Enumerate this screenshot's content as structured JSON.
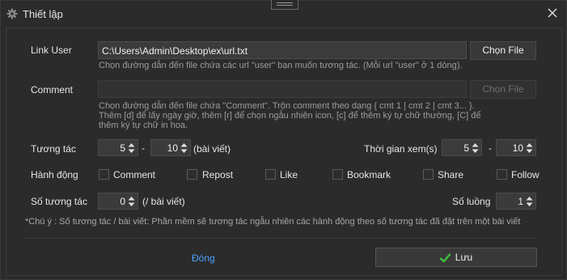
{
  "window": {
    "title": "Thiết lập",
    "title_icon": "gear-icon",
    "close_icon": "close-icon"
  },
  "link_user": {
    "label": "Link User",
    "value": "C:\\Users\\Admin\\Desktop\\ex\\url.txt",
    "button": "Chọn File",
    "hint": "Chọn đường dẫn đến file chứa các url \"user\" bạn muốn tương tác. (Mỗi url \"user\" ở 1 dòng)."
  },
  "comment": {
    "label": "Comment",
    "value": "",
    "button": "Chọn File",
    "hint_line1": "Chọn đường dẫn đến file chứa \"Comment\". Trộn comment theo dạng { cmt 1 | cmt 2 | cmt 3... }.",
    "hint_line2": "Thêm [d] để lấy ngày giờ, thêm [r] để chọn ngẫu nhiên icon, [c] để thêm ký tự chữ thường, [C] để",
    "hint_line3": "thêm ký tự chữ in hoa."
  },
  "tuong_tac": {
    "label": "Tương tác",
    "min": "5",
    "max": "10",
    "unit": "(bài viết)",
    "dash": "-"
  },
  "thoi_gian": {
    "label": "Thời gian xem(s)",
    "min": "5",
    "max": "10",
    "dash": "-"
  },
  "hanh_dong": {
    "label": "Hành động",
    "options": [
      {
        "label": "Comment",
        "checked": false
      },
      {
        "label": "Repost",
        "checked": false
      },
      {
        "label": "Like",
        "checked": false
      },
      {
        "label": "Bookmark",
        "checked": false
      },
      {
        "label": "Share",
        "checked": false
      },
      {
        "label": "Follow",
        "checked": false
      }
    ]
  },
  "so_tuong_tac": {
    "label": "Số tương tác",
    "value": "0",
    "unit": "(/ bài viết)"
  },
  "so_luong": {
    "label": "Số luồng",
    "value": "1"
  },
  "note": "*Chú ý : Số tương tác / bài viết: Phần mềm sẽ tương tác ngẫu nhiên các hành động theo số tương tác đã đặt trên một bài viết",
  "footer": {
    "close_label": "Đóng",
    "save_label": "Lưu",
    "save_icon": "check-icon",
    "accent": "#4aa3ff",
    "check_color": "#3cc43c"
  }
}
